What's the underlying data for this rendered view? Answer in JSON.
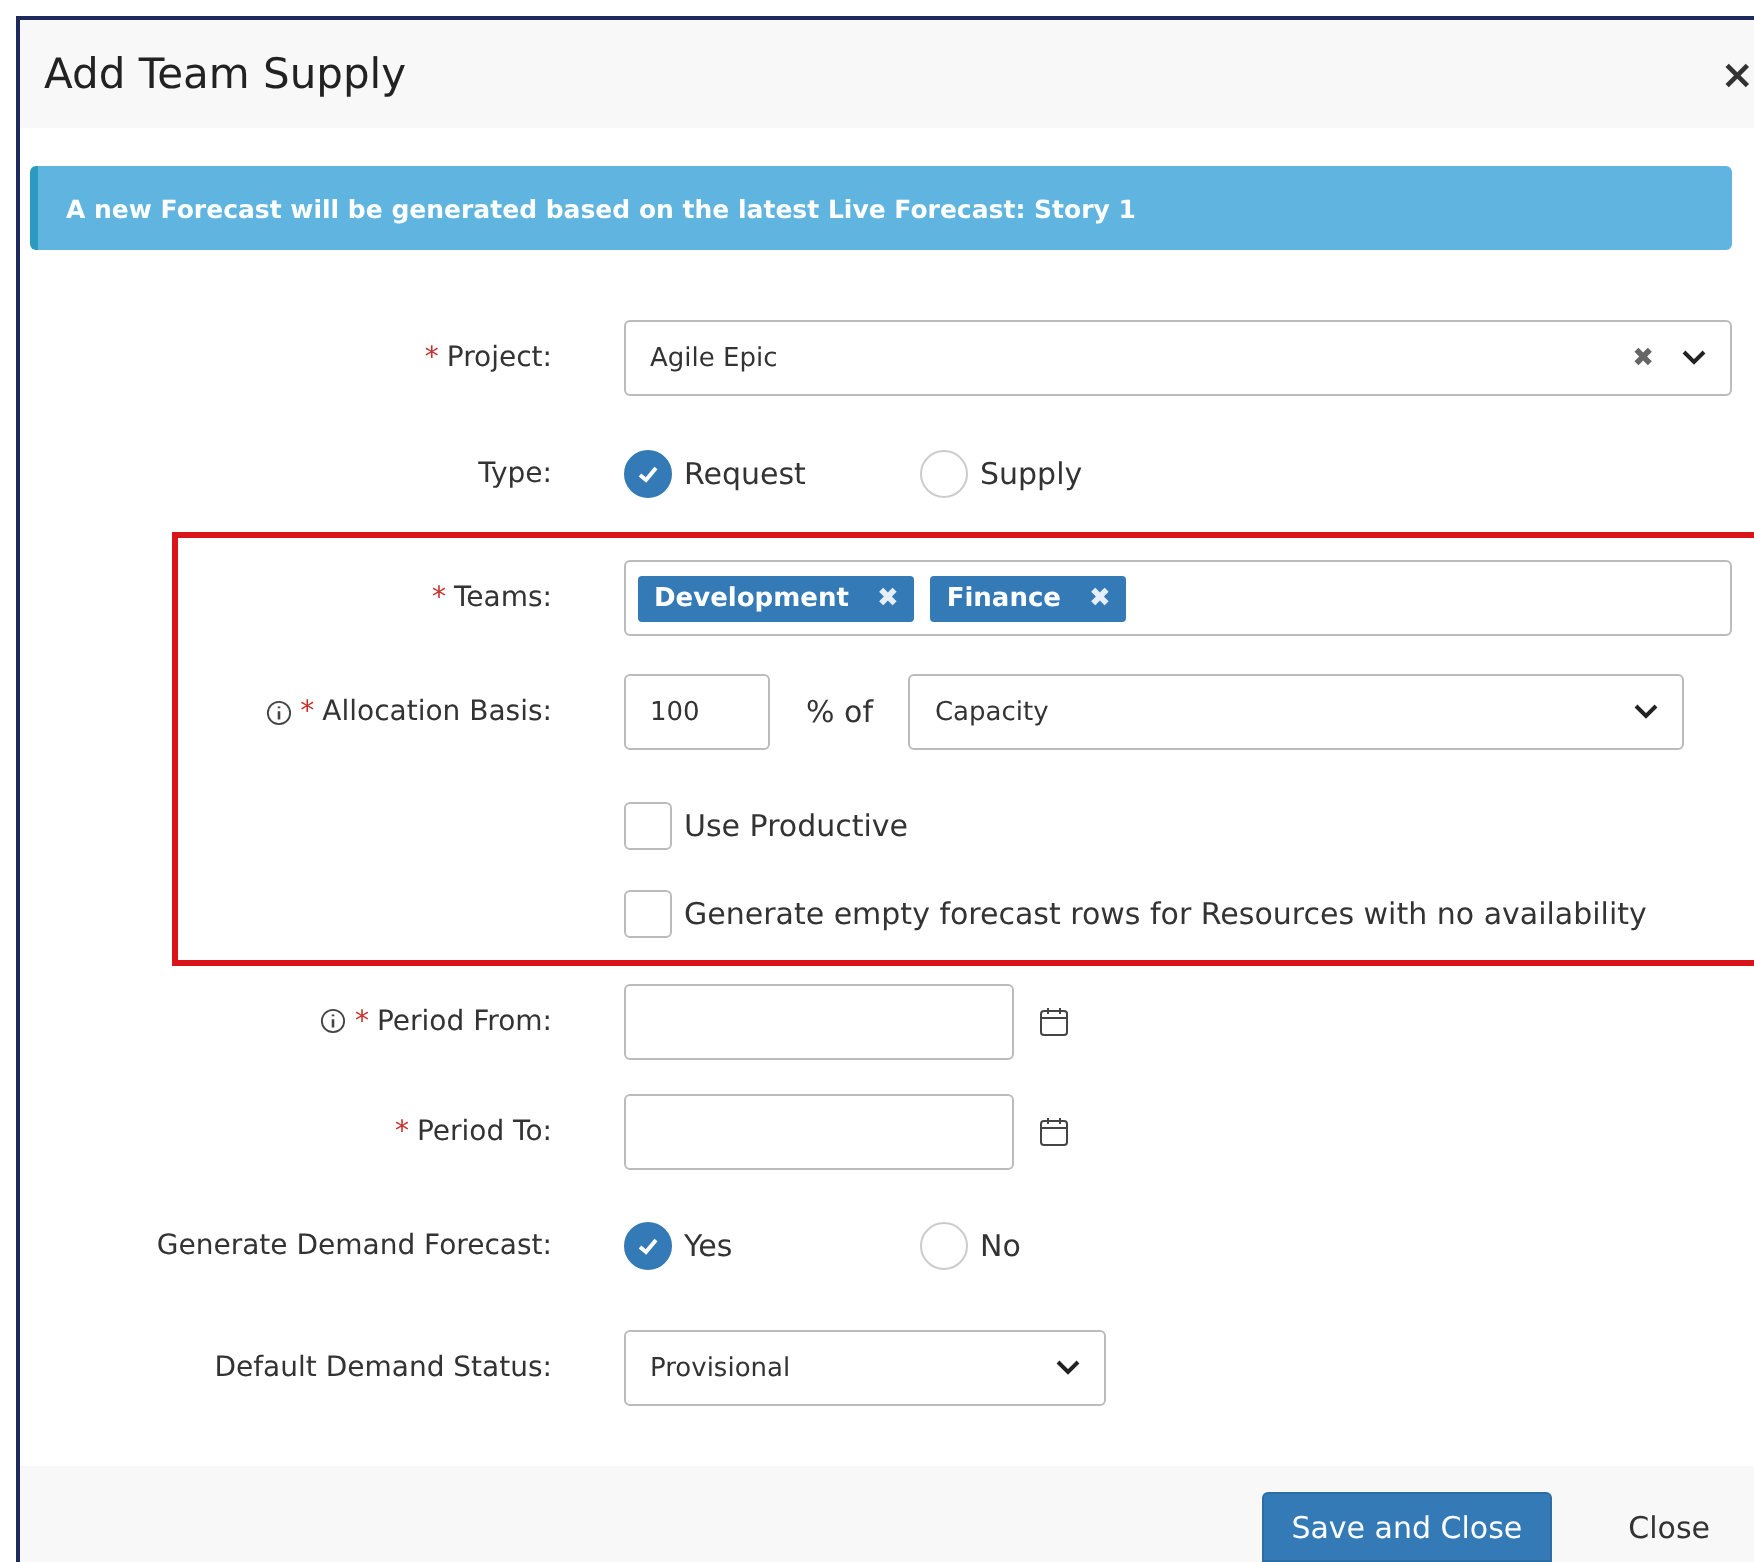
{
  "dialog": {
    "title": "Add Team Supply",
    "close": "×"
  },
  "alert": "A new Forecast will be generated based on the latest Live Forecast: Story 1",
  "sections": [
    {
      "highlighted": false,
      "fields": [
        {
          "kind": "combo",
          "label": "Project:",
          "required_mark": "*",
          "value": "Agile Epic",
          "clear": "✖"
        },
        {
          "kind": "radio",
          "label": "Type:",
          "options": [
            {
              "label": "Request",
              "selected": true
            },
            {
              "label": "Supply",
              "selected": false
            }
          ]
        }
      ]
    },
    {
      "highlighted": true,
      "fields": [
        {
          "kind": "tags",
          "label": "Teams:",
          "required_mark": "*",
          "tags": [
            {
              "label": "Development",
              "remove": "✖"
            },
            {
              "label": "Finance",
              "remove": "✖"
            }
          ]
        },
        {
          "kind": "allocation",
          "label": "Allocation Basis:",
          "required_mark": "*",
          "info": true,
          "value": "100",
          "unit": "% of",
          "basis": "Capacity"
        },
        {
          "kind": "checkbox",
          "label": "Use Productive",
          "checked": false
        },
        {
          "kind": "checkbox",
          "label": "Generate empty forecast rows for Resources with no availability",
          "checked": false
        }
      ]
    },
    {
      "highlighted": false,
      "fields": [
        {
          "kind": "date",
          "label": "Period From:",
          "required_mark": "*",
          "info": true
        },
        {
          "kind": "date",
          "label": "Period To:",
          "required_mark": "*"
        },
        {
          "kind": "radio",
          "label": "Generate Demand Forecast:",
          "options": [
            {
              "label": "Yes",
              "selected": true
            },
            {
              "label": "No",
              "selected": false
            }
          ]
        },
        {
          "kind": "select",
          "label": "Default Demand Status:",
          "value": "Provisional"
        }
      ]
    }
  ],
  "buttons": [
    {
      "label": "Save and Close",
      "kind": "primary"
    },
    {
      "label": "Close",
      "kind": "link"
    }
  ]
}
